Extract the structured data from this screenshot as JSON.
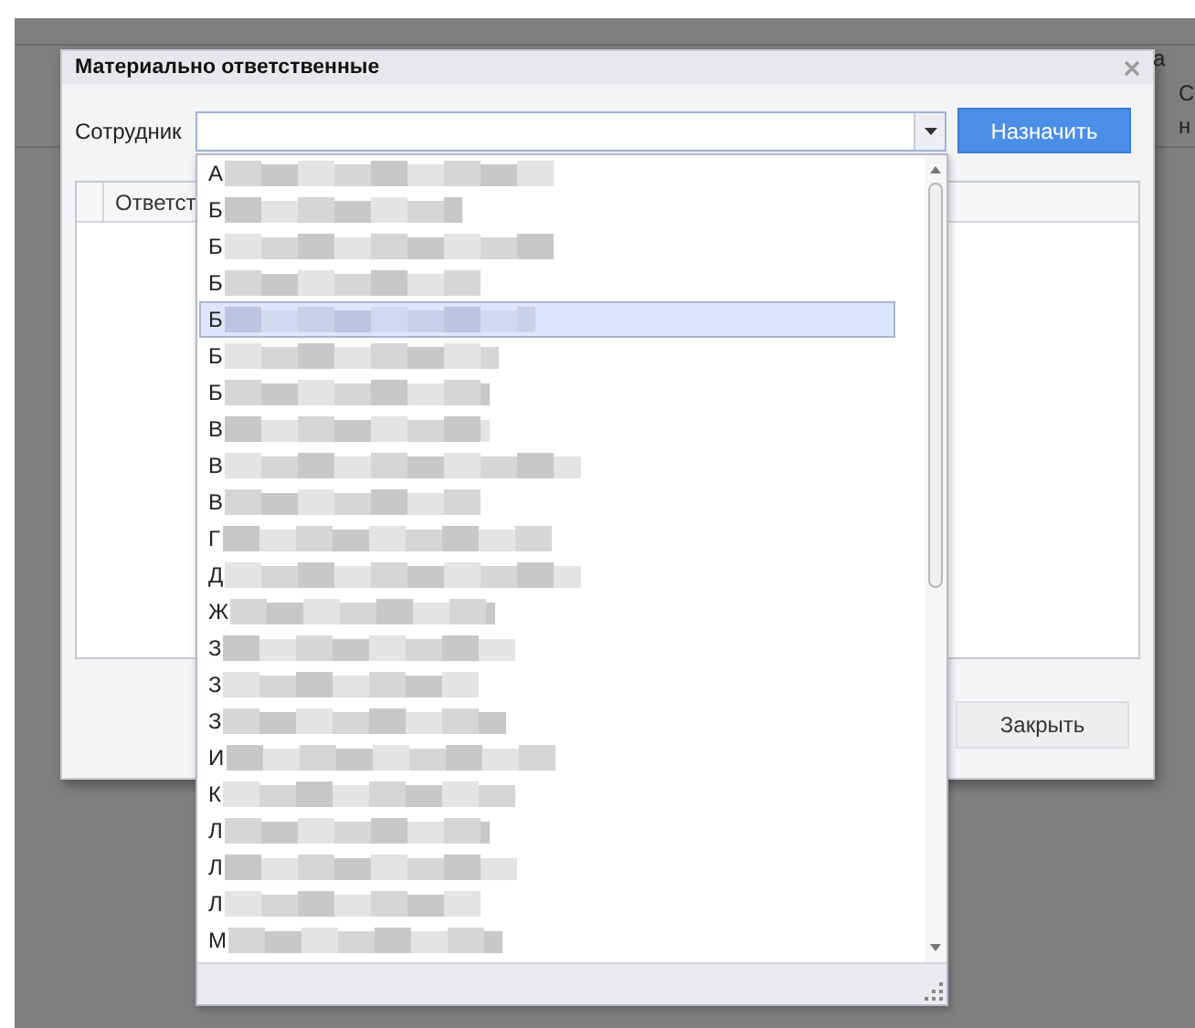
{
  "background": {
    "texts": [
      "а",
      "С",
      "н"
    ]
  },
  "dialog": {
    "title": "Материально ответственные",
    "field_label": "Сотрудник",
    "assign_button": "Назначить",
    "grid": {
      "columns": [
        "Ответст"
      ]
    },
    "close_button": "Закрыть"
  },
  "dropdown": {
    "items": [
      {
        "text": "А",
        "selected": false
      },
      {
        "text": "Б",
        "selected": false
      },
      {
        "text": "Б",
        "selected": false
      },
      {
        "text": "Б",
        "selected": false
      },
      {
        "text": "Б",
        "selected": true
      },
      {
        "text": "Б",
        "selected": false
      },
      {
        "text": "Б",
        "selected": false
      },
      {
        "text": "В",
        "selected": false
      },
      {
        "text": "В",
        "selected": false
      },
      {
        "text": "В",
        "selected": false
      },
      {
        "text": "Г",
        "selected": false
      },
      {
        "text": "Д",
        "selected": false
      },
      {
        "text": "Ж",
        "selected": false
      },
      {
        "text": "З",
        "selected": false
      },
      {
        "text": "З",
        "selected": false
      },
      {
        "text": "З",
        "selected": false
      },
      {
        "text": "И",
        "selected": false
      },
      {
        "text": "К",
        "selected": false
      },
      {
        "text": "Л",
        "selected": false
      },
      {
        "text": "Л",
        "selected": false
      },
      {
        "text": "Л",
        "selected": false
      },
      {
        "text": "М",
        "selected": false
      }
    ]
  }
}
